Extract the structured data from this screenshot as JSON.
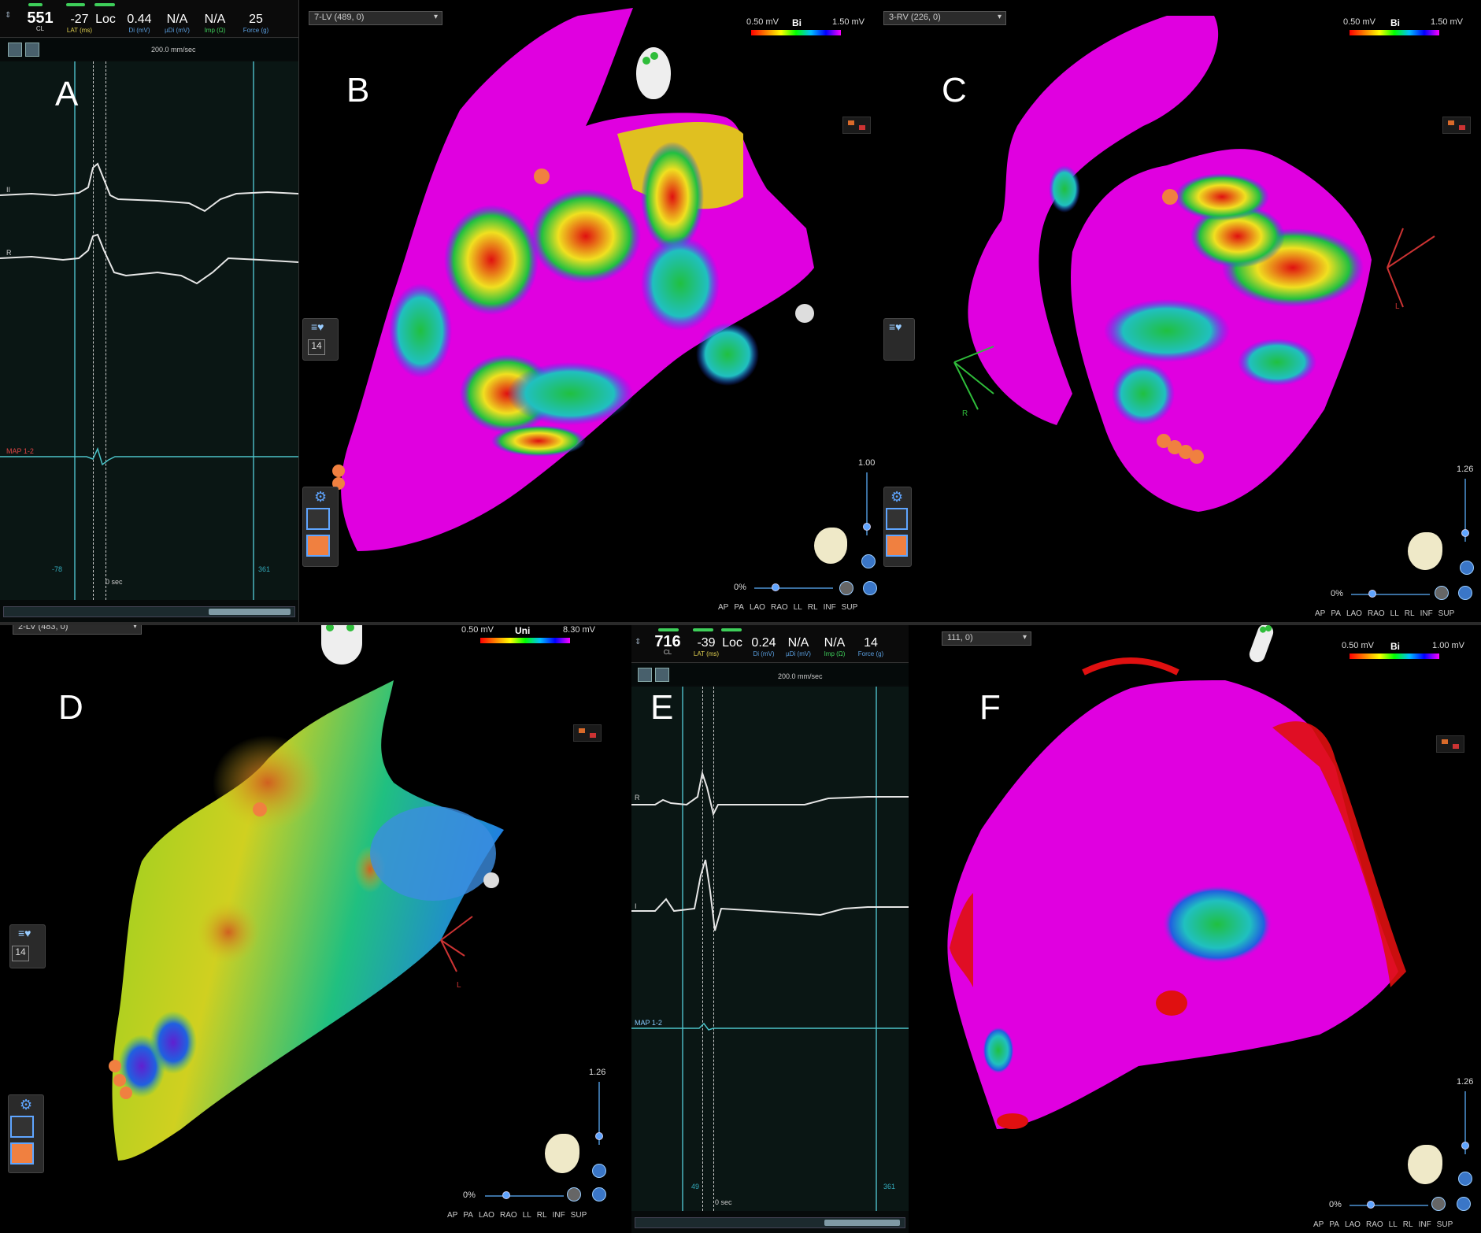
{
  "panels": {
    "A": {
      "letter": "A",
      "ecg": {
        "cl": "551",
        "cl_label": "CL",
        "lat": "-27",
        "lat_label": "LAT (ms)",
        "loc": "Loc",
        "di": "0.44",
        "di_label": "Di (mV)",
        "udi": "N/A",
        "udi_label": "µDi (mV)",
        "imp": "N/A",
        "imp_label": "Imp (Ω)",
        "force": "25",
        "force_label": "Force (g)",
        "sweep": "200.0 mm/sec",
        "trace1": "II",
        "trace2": "R",
        "trace3": "MAP 1-2",
        "win_left": "-78",
        "win_right": "361",
        "zero": "0 sec"
      }
    },
    "B": {
      "letter": "B",
      "map_name": "7-LV (489, 0)",
      "scale_lo": "0.50 mV",
      "scale_type": "Bi",
      "scale_hi": "1.50 mV",
      "zoom": "1.00",
      "opacity": "0%",
      "side_num": "14",
      "views": [
        "AP",
        "PA",
        "LAO",
        "RAO",
        "LL",
        "RL",
        "INF",
        "SUP"
      ]
    },
    "C": {
      "letter": "C",
      "map_name": "3-RV (226, 0)",
      "scale_lo": "0.50 mV",
      "scale_type": "Bi",
      "scale_hi": "1.50 mV",
      "zoom": "1.26",
      "opacity": "0%",
      "axis_r": "R",
      "axis_l": "L",
      "views": [
        "AP",
        "PA",
        "LAO",
        "RAO",
        "LL",
        "RL",
        "INF",
        "SUP"
      ]
    },
    "D": {
      "letter": "D",
      "map_name": "2-LV (483, 0)",
      "scale_lo": "0.50 mV",
      "scale_type": "Uni",
      "scale_hi": "8.30 mV",
      "zoom": "1.26",
      "opacity": "0%",
      "side_num": "14",
      "axis_l": "L",
      "views": [
        "AP",
        "PA",
        "LAO",
        "RAO",
        "LL",
        "RL",
        "INF",
        "SUP"
      ]
    },
    "E": {
      "letter": "E",
      "ecg": {
        "cl": "716",
        "cl_label": "CL",
        "lat": "-39",
        "lat_label": "LAT (ms)",
        "loc": "Loc",
        "di": "0.24",
        "di_label": "Di (mV)",
        "udi": "N/A",
        "udi_label": "µDi (mV)",
        "imp": "N/A",
        "imp_label": "Imp (Ω)",
        "force": "14",
        "force_label": "Force (g)",
        "sweep": "200.0 mm/sec",
        "trace1": "R",
        "trace2": "I",
        "trace3": "MAP 1-2",
        "win_left": "49",
        "win_right": "361",
        "zero": "0 sec"
      }
    },
    "F": {
      "letter": "F",
      "map_name": "111, 0)",
      "scale_lo": "0.50 mV",
      "scale_type": "Bi",
      "scale_hi": "1.00 mV",
      "zoom": "1.26",
      "opacity": "0%",
      "views": [
        "AP",
        "PA",
        "LAO",
        "RAO",
        "LL",
        "RL",
        "INF",
        "SUP"
      ]
    }
  },
  "colors": {
    "scar": "#e000e0",
    "border_green": "#22c040",
    "healthy_red": "#e01010",
    "cursor": "#3a8d94"
  }
}
